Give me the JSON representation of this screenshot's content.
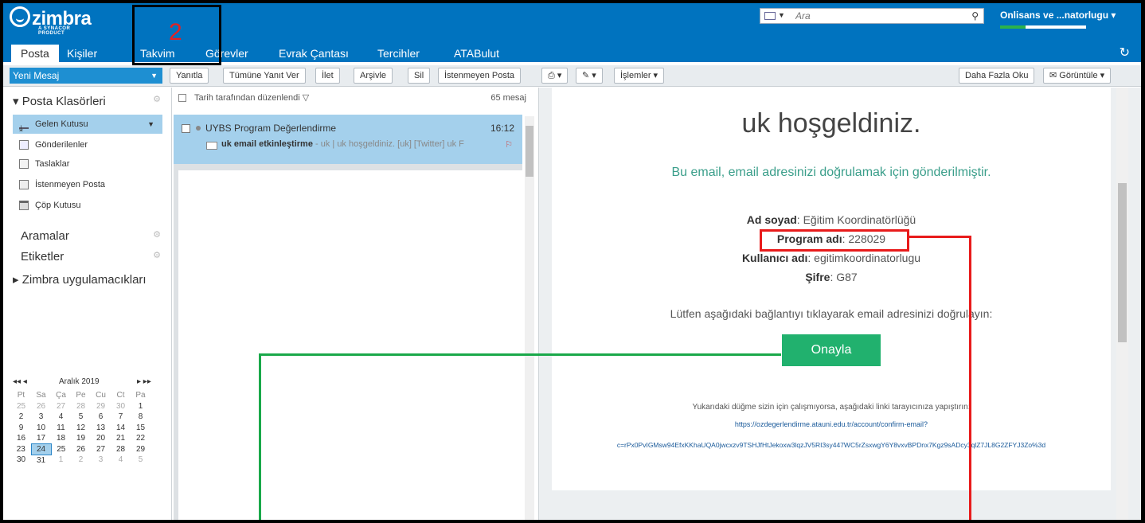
{
  "app": {
    "logo_text": "zimbra",
    "logo_sub": "A SYNACOR PRODUCT"
  },
  "search": {
    "placeholder": "Ara",
    "dropdown": "▼"
  },
  "user": {
    "name": "Onlisans ve ...natorlugu ▾",
    "quota_fraction": 0.3
  },
  "tabs": [
    {
      "label": "Posta"
    },
    {
      "label": "Kişiler"
    },
    {
      "label": "Takvim"
    },
    {
      "label": "Görevler"
    },
    {
      "label": "Evrak Çantası"
    },
    {
      "label": "Tercihler"
    },
    {
      "label": "ATABulut"
    }
  ],
  "annotation": {
    "number": "2"
  },
  "toolbar": {
    "new_message": "Yeni Mesaj",
    "reply": "Yanıtla",
    "reply_all": "Tümüne Yanıt Ver",
    "forward": "İlet",
    "archive": "Arşivle",
    "delete": "Sil",
    "spam": "İstenmeyen Posta",
    "actions": "İşlemler ▾",
    "read_more": "Daha Fazla Oku",
    "view": "Görüntüle ▾"
  },
  "sidebar": {
    "folders_header": "Posta Klasörleri",
    "folders": [
      {
        "label": "Gelen Kutusu",
        "icon": "inbox-icon"
      },
      {
        "label": "Gönderilenler",
        "icon": "sent-icon"
      },
      {
        "label": "Taslaklar",
        "icon": "drafts-icon"
      },
      {
        "label": "İstenmeyen Posta",
        "icon": "junk-icon"
      },
      {
        "label": "Çöp Kutusu",
        "icon": "trash-icon"
      }
    ],
    "searches": "Aramalar",
    "tags": "Etiketler",
    "zimlets": "Zimbra uygulamacıkları"
  },
  "calendar": {
    "month": "Aralık 2019",
    "prev": "◂◂ ◂",
    "next": "▸ ▸▸",
    "weekdays": [
      "Pt",
      "Sa",
      "Ça",
      "Pe",
      "Cu",
      "Ct",
      "Pa"
    ],
    "weeks": [
      [
        "25",
        "26",
        "27",
        "28",
        "29",
        "30",
        "1"
      ],
      [
        "2",
        "3",
        "4",
        "5",
        "6",
        "7",
        "8"
      ],
      [
        "9",
        "10",
        "11",
        "12",
        "13",
        "14",
        "15"
      ],
      [
        "16",
        "17",
        "18",
        "19",
        "20",
        "21",
        "22"
      ],
      [
        "23",
        "24",
        "25",
        "26",
        "27",
        "28",
        "29"
      ],
      [
        "30",
        "31",
        "1",
        "2",
        "3",
        "4",
        "5"
      ]
    ],
    "today": "24"
  },
  "list": {
    "sort_label": "Tarih tarafından düzenlendi",
    "count": "65 mesaj",
    "message": {
      "from": "UYBS Program Değerlendirme",
      "time": "16:12",
      "subject": "uk email etkinleştirme",
      "preview": " - uk | uk hoşgeldiniz. [uk] [Twitter] uk F"
    }
  },
  "email": {
    "welcome": "uk hoşgeldiniz.",
    "verify": "Bu email, email adresinizi doğrulamak için gönderilmiştir.",
    "fields": [
      {
        "label": "Ad soyad",
        "value": ": Eğitim Koordinatörlüğü"
      },
      {
        "label": "Program adı",
        "value": ": 228029"
      },
      {
        "label": "Kullanıcı adı",
        "value": ": egitimkoordinatorlugu"
      },
      {
        "label": "Şifre",
        "value": ": G87"
      }
    ],
    "prompt": "Lütfen aşağıdaki bağlantıyı tıklayarak email adresinizi doğrulayın:",
    "button": "Onayla",
    "fallback": "Yukarıdaki düğme sizin için çalışmıyorsa, aşağıdaki linki tarayıcınıza yapıştırın:",
    "link_line1": "https://ozdegerlendirme.atauni.edu.tr/account/confirm-email?",
    "link_line2": "c=rPx0PvIGMsw94EfxKKhaUQA0jwcxzv9TSHJfHtJekoxw3lqzJV5RI3sy447WC5rZsxwgY6Y8vxvBPDnx7Kgz9sADcy3qlZ7JL8G2ZFYJ3Zo%3d"
  },
  "colors": {
    "brand": "#0073bf",
    "selection": "#a4d0ec",
    "confirm_button": "#21b16e",
    "annotation_red": "#e81b1b",
    "annotation_green": "#1aa84a"
  }
}
